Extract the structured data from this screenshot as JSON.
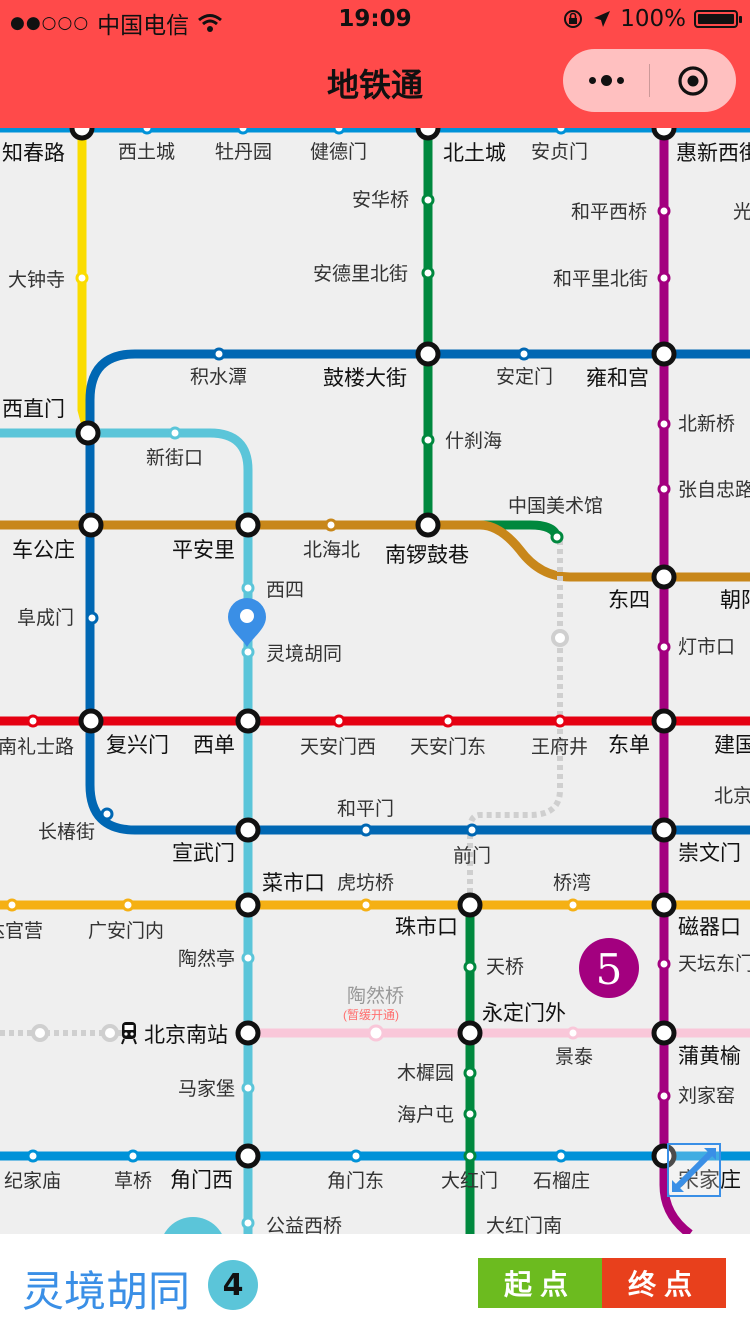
{
  "status_bar": {
    "signal": "●●○○○",
    "carrier": "中国电信",
    "time": "19:09",
    "battery": "100%"
  },
  "nav": {
    "title": "地铁通"
  },
  "map": {
    "labels": {
      "zhichunlu": "知春路",
      "xitucheng": "西土城",
      "mudanyuan": "牡丹园",
      "jiandemen": "健德门",
      "beitucheng": "北土城",
      "anzhenmen": "安贞门",
      "huixinxijie": "惠新西街",
      "anhuaqiao": "安华桥",
      "hepingxiqiao": "和平西桥",
      "guang": "光",
      "dazhongsi": "大钟寺",
      "andelibeijie": "安德里北街",
      "hepinglibeijie": "和平里北街",
      "jishuitan": "积水潭",
      "guloudajie": "鼓楼大街",
      "andingmen": "安定门",
      "yonghegong": "雍和宫",
      "xizhimen": "西直门",
      "beixinqiao": "北新桥",
      "xinjiekou": "新街口",
      "shichahai": "什刹海",
      "zhangzizhonglu": "张自忠路",
      "zhongguomeishuguan": "中国美术馆",
      "chegongzhuang": "车公庄",
      "pinganli": "平安里",
      "beihaibei": "北海北",
      "nanluoguxiang": "南锣鼓巷",
      "dongsi": "东四",
      "chaoyang": "朝阳",
      "xisi": "西四",
      "fuchengmen": "阜成门",
      "lingjinghutong": "灵境胡同",
      "dengshikou": "灯市口",
      "nanlishilu": "南礼士路",
      "fuxingmen": "复兴门",
      "xidan": "西单",
      "tiananmenxi": "天安门西",
      "tiananmendong": "天安门东",
      "wangfujing": "王府井",
      "dongdan": "东单",
      "jianguomen": "建国",
      "beijingzhan": "北京",
      "hepingmen": "和平门",
      "changchunjie": "长椿街",
      "xuanwumen": "宣武门",
      "qianmen": "前门",
      "chongwenmen": "崇文门",
      "caishikou": "菜市口",
      "hufangqiao": "虎坊桥",
      "qiaowan": "桥湾",
      "daguanying": "达官营",
      "guanganmennei": "广安门内",
      "zhushikou": "珠市口",
      "ciqikou": "磁器口",
      "taorantin": "陶然亭",
      "tianqiao": "天桥",
      "tiantandongmen": "天坛东门",
      "taoranqiao": "陶然桥",
      "suspended": "(暂缓开通)",
      "yongdingmenwai": "永定门外",
      "beijingnanzhan": "北京南站",
      "jingtai": "景泰",
      "puhuangyu": "蒲黄榆",
      "muxiyuan": "木樨园",
      "majiapu": "马家堡",
      "liujiayao": "刘家窑",
      "haihutun": "海户屯",
      "jijiamiao": "纪家庙",
      "caoqiao": "草桥",
      "jiaomenxi": "角门西",
      "jiaomendong": "角门东",
      "dahongmen": "大红门",
      "shiliuzhuang": "石榴庄",
      "songjiazhuang": "宋家庄",
      "gongyixiqiao": "公益西桥",
      "dahongmennan": "大红门南"
    },
    "line5_badge": "5",
    "colors": {
      "line1": "#e50012",
      "line2": "#0067b3",
      "line4": "#5bc5d9",
      "line5": "#a3007f",
      "line6": "#c8871a",
      "line7": "#f5b014",
      "line8": "#00883e",
      "line10": "#0092d8",
      "line13": "#fadc00",
      "line14": "#f9c7d9",
      "marker": "#3a8fe6"
    }
  },
  "bottom": {
    "station": "灵境胡同",
    "line_badge": "4",
    "start_label": "起点",
    "end_label": "终点"
  }
}
